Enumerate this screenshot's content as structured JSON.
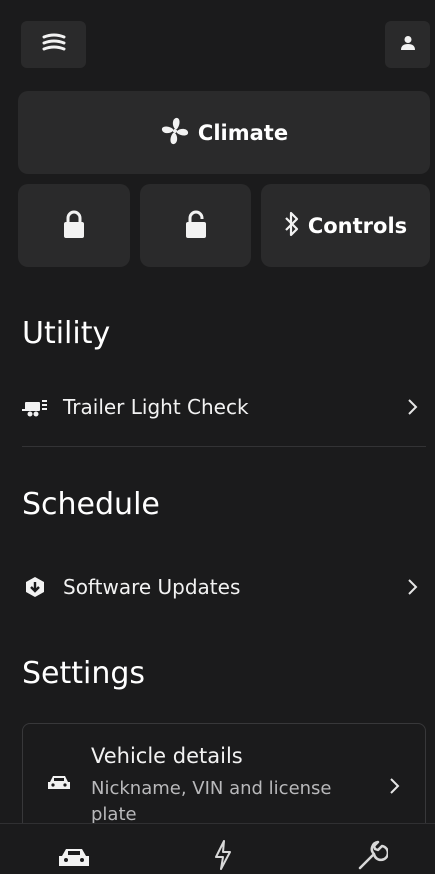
{
  "header": {
    "menu_icon": "stacked-lines-icon",
    "profile_icon": "person-icon"
  },
  "tiles": {
    "climate_label": "Climate",
    "climate_icon": "fan-icon",
    "lock_icon": "lock-icon",
    "unlock_icon": "unlock-icon",
    "controls_label": "Controls",
    "controls_icon": "bluetooth-icon"
  },
  "utility": {
    "title": "Utility",
    "items": [
      {
        "label": "Trailer Light Check",
        "icon": "trailer-icon"
      }
    ]
  },
  "schedule": {
    "title": "Schedule",
    "items": [
      {
        "label": "Software Updates",
        "icon": "software-update-icon"
      }
    ]
  },
  "settings": {
    "title": "Settings",
    "vehicle_details": {
      "title": "Vehicle details",
      "subtitle": "Nickname, VIN and license plate",
      "icon": "car-icon"
    }
  },
  "bottom_nav": {
    "items": [
      {
        "icon": "car-icon",
        "active": true
      },
      {
        "icon": "lightning-icon",
        "active": false
      },
      {
        "icon": "wrench-icon",
        "active": false
      }
    ]
  },
  "colors": {
    "background": "#1b1b1c",
    "surface": "#2a2a2b",
    "text": "#f2f2f2"
  }
}
